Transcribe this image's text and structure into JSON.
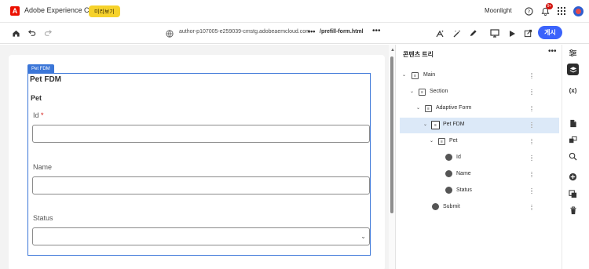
{
  "header": {
    "brand": "Adobe Experience Cloud",
    "preview_badge": "미리보기",
    "org": "Moonlight",
    "notif_count": "9+"
  },
  "toolbar": {
    "url": "author-p107005-e259039-cmstg.adobeaemcloud.com",
    "separator": "•••",
    "path": "/prefill-form.html",
    "more": "•••",
    "publish_label": "게시"
  },
  "canvas": {
    "selection_tag": "Pet FDM",
    "form_title": "Pet FDM",
    "section_title": "Pet",
    "fields": [
      {
        "label": "Id",
        "required_mark": "*",
        "value": ""
      },
      {
        "label": "Name",
        "value": ""
      },
      {
        "label": "Status",
        "value": ""
      }
    ]
  },
  "tree": {
    "title": "콘텐츠 트리",
    "more": "•••",
    "nodes": [
      {
        "label": "Main"
      },
      {
        "label": "Section"
      },
      {
        "label": "Adaptive Form"
      },
      {
        "label": "Pet FDM"
      },
      {
        "label": "Pet"
      },
      {
        "label": "Id"
      },
      {
        "label": "Name"
      },
      {
        "label": "Status"
      },
      {
        "label": "Submit"
      }
    ]
  },
  "rail": {
    "icons": [
      "properties-icon",
      "layers-icon",
      "variables-icon",
      "document-icon",
      "replace-icon",
      "search-icon",
      "add-icon",
      "duplicate-icon",
      "delete-icon"
    ],
    "variables_glyph": "(x)"
  },
  "colors": {
    "accent": "#3b63fb",
    "selection": "#3b76d8",
    "brand_red": "#eb1000",
    "badge_yellow": "#f6d22b"
  }
}
